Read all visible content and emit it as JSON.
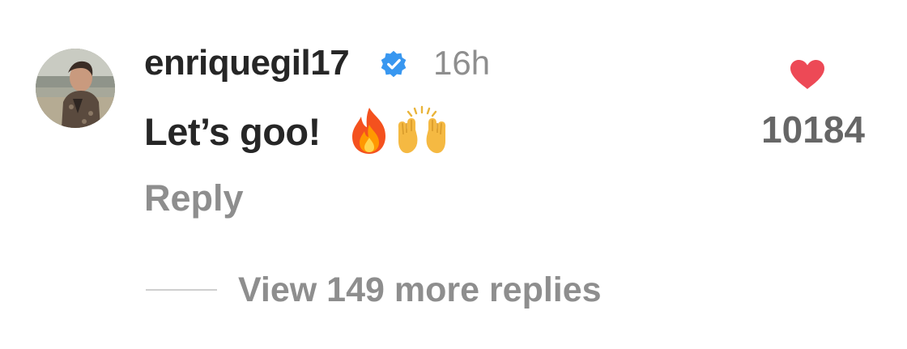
{
  "comment": {
    "username": "enriquegil17",
    "verified": true,
    "timestamp": "16h",
    "text": "Let’s goo!",
    "emojis": [
      "fire-emoji",
      "raising-hands-emoji"
    ],
    "likes": "10184",
    "reply_label": "Reply",
    "view_replies_label": "View 149 more replies"
  },
  "colors": {
    "username": "#262626",
    "muted": "#8e8e8e",
    "like_count": "#666666",
    "heart": "#ed4956",
    "verified_badge": "#3897f0",
    "divider": "#cfcfcf"
  }
}
